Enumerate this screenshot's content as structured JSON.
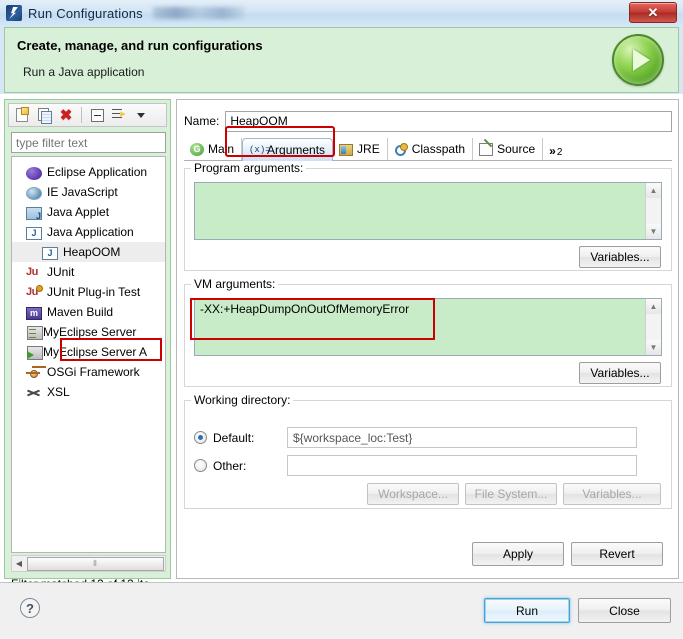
{
  "window": {
    "title": "Run Configurations",
    "close_label": "✕",
    "app_icon": "eclipse-icon"
  },
  "banner": {
    "title": "Create, manage, and run configurations",
    "subtitle": "Run a Java application",
    "icon": "run-play-icon"
  },
  "tree_toolbar": {
    "new_label": "",
    "duplicate_label": "",
    "delete_label": "✖",
    "collapse_label": "",
    "filter_label": "",
    "menu_label": ""
  },
  "filter": {
    "placeholder": "type filter text",
    "value": "",
    "status": "Filter matched 12 of 12 ite"
  },
  "tree": {
    "items": [
      {
        "label": "Eclipse Application",
        "icon": "eclipse-sphere-icon",
        "level": 0,
        "selected": false
      },
      {
        "label": "IE JavaScript",
        "icon": "globe-icon",
        "level": 0,
        "selected": false
      },
      {
        "label": "Java Applet",
        "icon": "java-applet-icon",
        "level": 0,
        "selected": false
      },
      {
        "label": "Java Application",
        "icon": "java-application-icon",
        "level": 0,
        "selected": false
      },
      {
        "label": "HeapOOM",
        "icon": "java-application-icon",
        "level": 1,
        "selected": true
      },
      {
        "label": "JUnit",
        "icon": "junit-icon",
        "level": 0,
        "selected": false
      },
      {
        "label": "JUnit Plug-in Test",
        "icon": "junit-plugin-icon",
        "level": 0,
        "selected": false
      },
      {
        "label": "Maven Build",
        "icon": "maven-icon",
        "level": 0,
        "selected": false
      },
      {
        "label": "MyEclipse Server",
        "icon": "server-icon",
        "level": 0,
        "selected": false
      },
      {
        "label": "MyEclipse Server A",
        "icon": "server-run-icon",
        "level": 0,
        "selected": false
      },
      {
        "label": "OSGi Framework",
        "icon": "osgi-icon",
        "level": 0,
        "selected": false
      },
      {
        "label": "XSL",
        "icon": "xsl-icon",
        "level": 0,
        "selected": false
      }
    ],
    "hscroll_left_arrow": "◀",
    "hscroll_thumb": "⦀"
  },
  "config": {
    "name_label": "Name:",
    "name_value": "HeapOOM",
    "tabs": [
      {
        "label": "Main",
        "icon": "main-tab-icon",
        "active": false
      },
      {
        "label": "Arguments",
        "icon": "arguments-tab-icon",
        "active": true
      },
      {
        "label": "JRE",
        "icon": "jre-tab-icon",
        "active": false
      },
      {
        "label": "Classpath",
        "icon": "classpath-tab-icon",
        "active": false
      },
      {
        "label": "Source",
        "icon": "source-tab-icon",
        "active": false
      }
    ],
    "tab_overflow": {
      "chevron": "»",
      "count": "2"
    },
    "program_arguments": {
      "label": "Program arguments:",
      "value": "",
      "variables_button": "Variables...",
      "scroll_up": "▲",
      "scroll_down": "▼"
    },
    "vm_arguments": {
      "label": "VM arguments:",
      "value": "-XX:+HeapDumpOnOutOfMemoryError",
      "variables_button": "Variables...",
      "scroll_up": "▲",
      "scroll_down": "▼"
    },
    "working_directory": {
      "label": "Working directory:",
      "default_radio_label": "Default:",
      "default_value": "${workspace_loc:Test}",
      "default_selected": true,
      "other_radio_label": "Other:",
      "other_value": "",
      "other_selected": false,
      "workspace_button": "Workspace...",
      "filesystem_button": "File System...",
      "variables_button": "Variables..."
    },
    "apply_button": "Apply",
    "revert_button": "Revert"
  },
  "footer": {
    "help_label": "?",
    "run_button": "Run",
    "close_button": "Close"
  },
  "colors": {
    "banner_green": "#d7f0d7",
    "field_green": "#c8ecc8",
    "highlight_red": "#cc0000",
    "accent_blue": "#4a9fd4"
  }
}
